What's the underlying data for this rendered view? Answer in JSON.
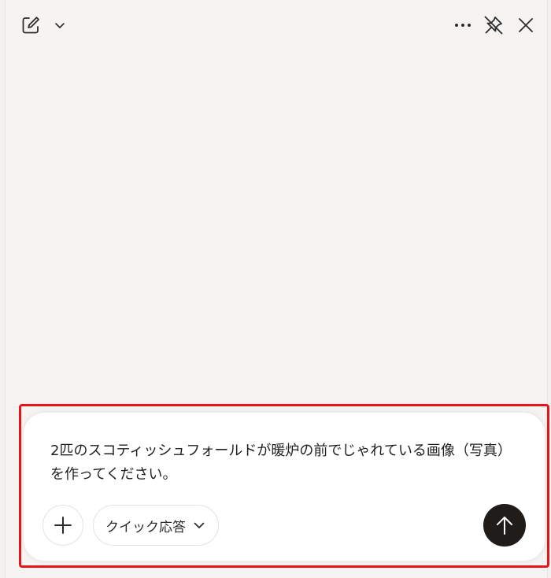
{
  "titlebar": {
    "icons": {
      "new_chat": "compose-icon",
      "new_chat_menu": "chevron-down-icon",
      "more": "more-icon",
      "unpin": "unpin-icon",
      "close": "close-icon"
    }
  },
  "composer": {
    "message_text": "2匹のスコティッシュフォールドが暖炉の前でじゃれている画像（写真）を作ってください。",
    "mode_label": "クイック応答",
    "icons": {
      "attach": "plus-icon",
      "mode_menu": "chevron-down-icon",
      "send": "arrow-up-icon"
    }
  },
  "colors": {
    "background": "#f6f4f2",
    "highlight": "#e8141a",
    "send_button": "#1f1c1a",
    "icon": "#2b2b2b"
  }
}
